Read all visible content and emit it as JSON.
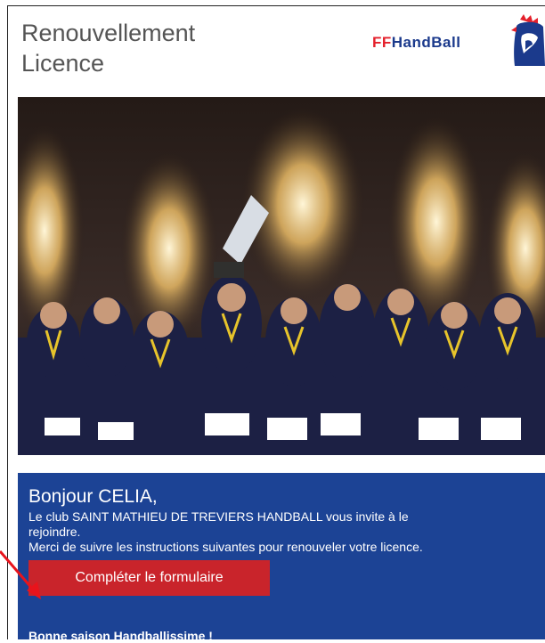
{
  "header": {
    "title_line1": "Renouvellement",
    "title_line2": "Licence",
    "logo_ff": "FF",
    "logo_handball": "HandBall"
  },
  "panel": {
    "greeting": "Bonjour CELIA,",
    "message_line1": "Le club SAINT MATHIEU DE TREVIERS HANDBALL vous invite à le",
    "message_line2": "rejoindre.",
    "message_line3": "Merci de suivre les instructions suivantes pour renouveler votre licence.",
    "cta_label": "Compléter le formulaire",
    "closing": "Bonne saison Handballissime !"
  },
  "colors": {
    "panel_bg": "#1c4395",
    "cta_bg": "#c9242b",
    "logo_red": "#e4202b",
    "logo_blue": "#1b3a8c",
    "arrow": "#e8141c"
  },
  "icons": {
    "logo": "rooster-logo-icon",
    "annotation": "red-arrow-icon"
  }
}
